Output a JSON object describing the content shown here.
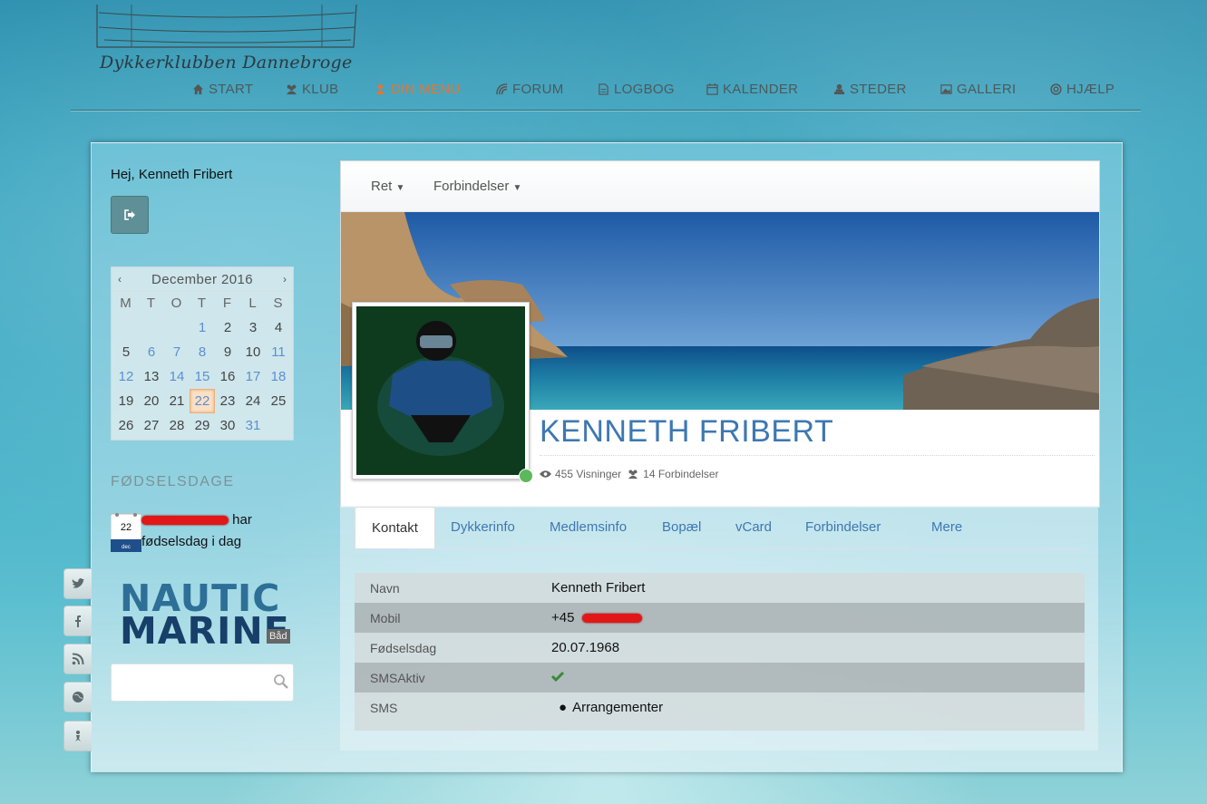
{
  "header": {
    "logo_text": "Dykkerklubben Dannebroge",
    "nav": [
      {
        "label": "START",
        "icon": "home-icon",
        "active": false
      },
      {
        "label": "KLUB",
        "icon": "users-icon",
        "active": false
      },
      {
        "label": "DIN MENU",
        "icon": "user-icon",
        "active": true
      },
      {
        "label": "FORUM",
        "icon": "forum-icon",
        "active": false
      },
      {
        "label": "LOGBOG",
        "icon": "file-icon",
        "active": false
      },
      {
        "label": "KALENDER",
        "icon": "calendar-icon",
        "active": false
      },
      {
        "label": "STEDER",
        "icon": "anchor-icon",
        "active": false
      },
      {
        "label": "GALLERI",
        "icon": "image-icon",
        "active": false
      },
      {
        "label": "HJÆLP",
        "icon": "lifebuoy-icon",
        "active": false
      }
    ],
    "accent_color": "#e0763a"
  },
  "sidebar": {
    "greeting": "Hej, Kenneth Fribert",
    "calendar": {
      "prev": "‹",
      "next": "›",
      "title": "December 2016",
      "weekdays": [
        "M",
        "T",
        "O",
        "T",
        "F",
        "L",
        "S"
      ],
      "weeks": [
        [
          "",
          "",
          "",
          "1",
          "2",
          "3",
          "4"
        ],
        [
          "5",
          "6",
          "7",
          "8",
          "9",
          "10",
          "11"
        ],
        [
          "12",
          "13",
          "14",
          "15",
          "16",
          "17",
          "18"
        ],
        [
          "19",
          "20",
          "21",
          "22",
          "23",
          "24",
          "25"
        ],
        [
          "26",
          "27",
          "28",
          "29",
          "30",
          "31",
          ""
        ]
      ],
      "today": "22"
    },
    "birthdays_title": "FØDSELSDAGE",
    "birthday_icon_day": "22",
    "birthday_icon_month": "dec",
    "birthday_suffix": "har",
    "birthday_line2": "fødselsdag i dag",
    "sponsor_line1": "NAUTIC",
    "sponsor_line2": "MARINE",
    "sponsor_badge": "Båd",
    "search_placeholder": ""
  },
  "social": [
    "twitter-icon",
    "facebook-icon",
    "rss-icon",
    "globe-icon",
    "diver-icon"
  ],
  "profile": {
    "toolbar": {
      "edit": "Ret",
      "connections": "Forbindelser"
    },
    "name": "KENNETH FRIBERT",
    "views": "455 Visninger",
    "connections": "14 Forbindelser",
    "online_color": "#5cb85c"
  },
  "tabs": [
    "Kontakt",
    "Dykkerinfo",
    "Medlemsinfo",
    "Bopæl",
    "vCard",
    "Forbindelser",
    "Mere"
  ],
  "contact": {
    "rows": [
      {
        "label": "Navn",
        "value": "Kenneth Fribert"
      },
      {
        "label": "Mobil",
        "value": "+45"
      },
      {
        "label": "Fødselsdag",
        "value": "20.07.1968"
      },
      {
        "label": "SMSAktiv",
        "value": ""
      },
      {
        "label": "SMS",
        "value": "Arrangementer"
      }
    ]
  }
}
